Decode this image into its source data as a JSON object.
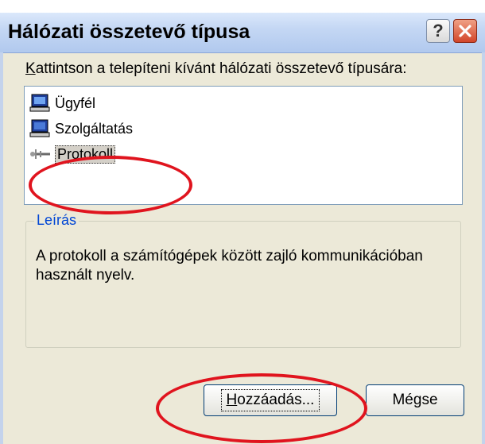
{
  "window": {
    "title": "Hálózati összetevő típusa",
    "help_symbol": "?"
  },
  "instruction": {
    "prefix_underlined": "K",
    "rest": "attintson a telepíteni kívánt hálózati összetevő típusára:"
  },
  "list": {
    "items": [
      {
        "label": "Ügyfél",
        "icon": "client-computer-icon",
        "selected": false
      },
      {
        "label": "Szolgáltatás",
        "icon": "service-computer-icon",
        "selected": false
      },
      {
        "label": "Protokoll",
        "icon": "protocol-network-icon",
        "selected": true
      }
    ]
  },
  "description": {
    "legend": "Leírás",
    "text": "A protokoll a számítógépek között zajló kommunikációban használt nyelv."
  },
  "buttons": {
    "add_underlined": "H",
    "add_rest": "ozzáadás...",
    "cancel": "Mégse"
  },
  "colors": {
    "annotation": "#e0141e",
    "title_gradient_top": "#dbe8fb",
    "close_button": "#d2452a",
    "group_legend": "#0046d5"
  }
}
